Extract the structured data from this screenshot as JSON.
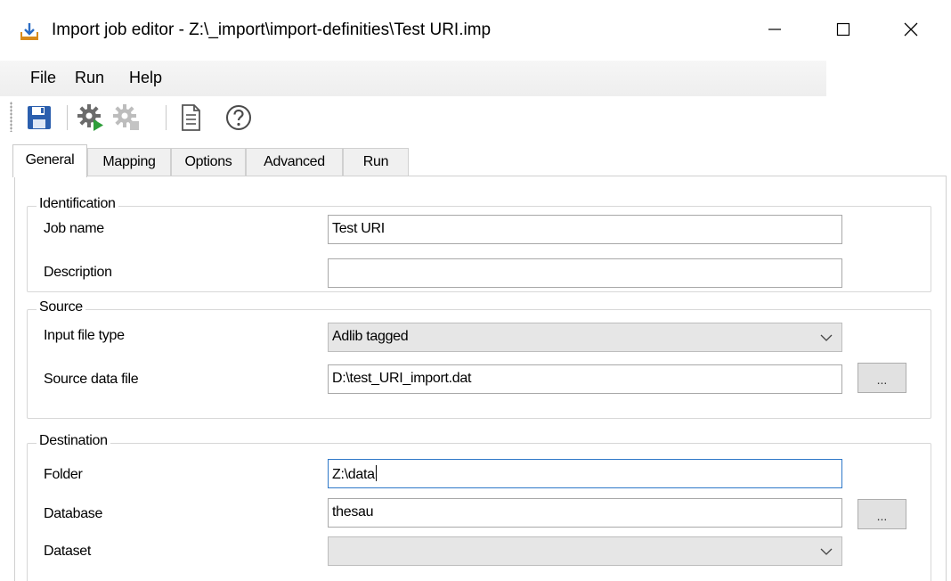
{
  "window": {
    "title": "Import job editor - Z:\\_import\\import-definities\\Test URI.imp",
    "minimize_glyph": "—",
    "maximize_glyph": "☐",
    "close_glyph": "✕"
  },
  "menu": [
    "File",
    "Run",
    "Help"
  ],
  "toolbar": {
    "icons": [
      "save-icon",
      "run-gear-icon",
      "gear-disabled-icon",
      "document-icon",
      "help-icon"
    ]
  },
  "tabs": [
    "General",
    "Mapping",
    "Options",
    "Advanced",
    "Run"
  ],
  "active_tab": "General",
  "identification": {
    "title": "Identification",
    "job_name_label": "Job name",
    "job_name_value": "Test URI",
    "description_label": "Description",
    "description_value": ""
  },
  "source": {
    "title": "Source",
    "input_type_label": "Input file type",
    "input_type_value": "Adlib tagged",
    "data_file_label": "Source data file",
    "data_file_value": "D:\\test_URI_import.dat",
    "browse_label": "..."
  },
  "destination": {
    "title": "Destination",
    "folder_label": "Folder",
    "folder_value": "Z:\\data",
    "database_label": "Database",
    "database_value": "thesau",
    "dataset_label": "Dataset",
    "dataset_value": "",
    "browse_label": "..."
  },
  "colors": {
    "save_blue": "#2b5fae",
    "focus_border": "#2f78c8",
    "run_green": "#2e9e3a"
  }
}
